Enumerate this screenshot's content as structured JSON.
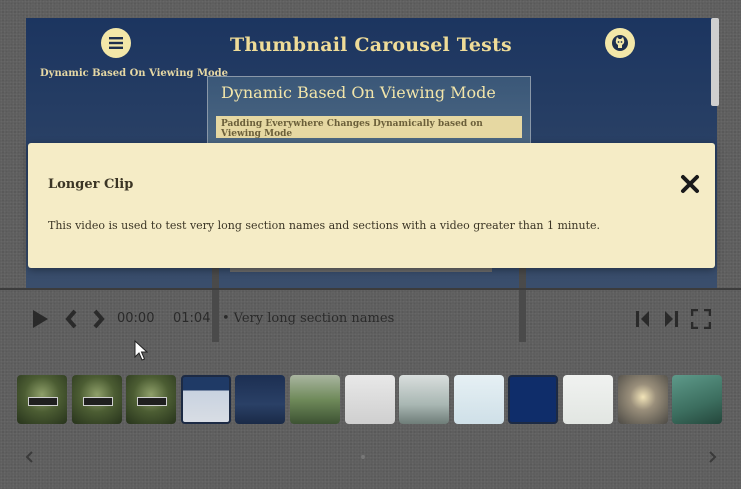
{
  "page": {
    "title": "Thumbnail Carousel Tests",
    "subtitle": "Dynamic Based On Viewing Mode",
    "section_card": {
      "title": "Dynamic Based On Viewing Mode",
      "description": "Padding Everywhere Changes Dynamically based on Viewing Mode"
    }
  },
  "modal": {
    "title": "Longer Clip",
    "body": "This video is used to test very long section names and sections with a video greater than 1 minute."
  },
  "player": {
    "current_time": "00:00",
    "duration": "01:04",
    "section_name": "Very long section names"
  },
  "thumbnails": [
    {
      "name": "thumb-1",
      "style": "poster"
    },
    {
      "name": "thumb-2",
      "style": "poster"
    },
    {
      "name": "thumb-3",
      "style": "poster"
    },
    {
      "name": "thumb-4",
      "style": "screen-light"
    },
    {
      "name": "thumb-5",
      "style": "screen-dark"
    },
    {
      "name": "thumb-6",
      "style": "nature"
    },
    {
      "name": "thumb-7",
      "style": "app-icons"
    },
    {
      "name": "thumb-8",
      "style": "misty"
    },
    {
      "name": "thumb-9",
      "style": "spreadsheet"
    },
    {
      "name": "thumb-10",
      "style": "solitaire"
    },
    {
      "name": "thumb-11",
      "style": "document"
    },
    {
      "name": "thumb-12",
      "style": "sunset"
    },
    {
      "name": "thumb-13",
      "style": "teal"
    }
  ],
  "colors": {
    "accent": "#f3e7a8",
    "page_bg": "#1c3560",
    "modal_bg": "#f5ecc6"
  }
}
